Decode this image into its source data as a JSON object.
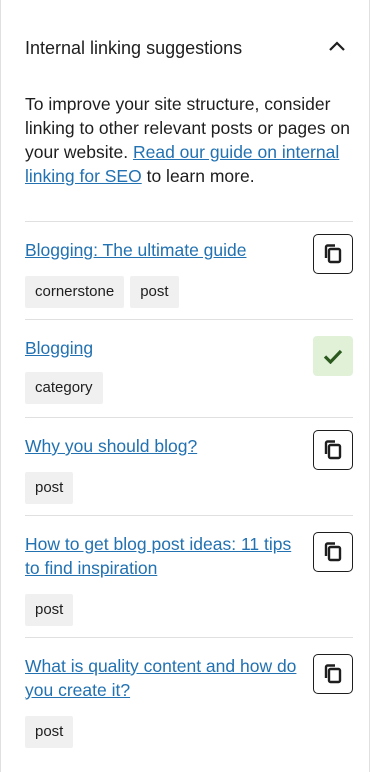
{
  "header": {
    "title": "Internal linking suggestions",
    "toggle_icon": "chevron-up-icon"
  },
  "intro": {
    "text_before": "To improve your site structure, consider linking to other relevant posts or pages on your website.",
    "link_text": "Read our guide on internal linking for SEO",
    "text_after": "to learn more."
  },
  "suggestions": [
    {
      "title": "Blogging: The ultimate guide",
      "tags": [
        "cornerstone",
        "post"
      ],
      "action": "copy-icon"
    },
    {
      "title": "Blogging",
      "tags": [
        "category"
      ],
      "action": "checkmark-icon"
    },
    {
      "title": "Why you should blog?",
      "tags": [
        "post"
      ],
      "action": "copy-icon"
    },
    {
      "title": "How to get blog post ideas: 11 tips to find inspiration",
      "tags": [
        "post"
      ],
      "action": "copy-icon"
    },
    {
      "title": "What is quality content and how do you create it?",
      "tags": [
        "post"
      ],
      "action": "copy-icon"
    }
  ],
  "colors": {
    "link": "#2271b1",
    "tag_bg": "#f0f0f0",
    "copied_bg": "#e0f1d8",
    "copied_check": "#2c5a1e"
  }
}
